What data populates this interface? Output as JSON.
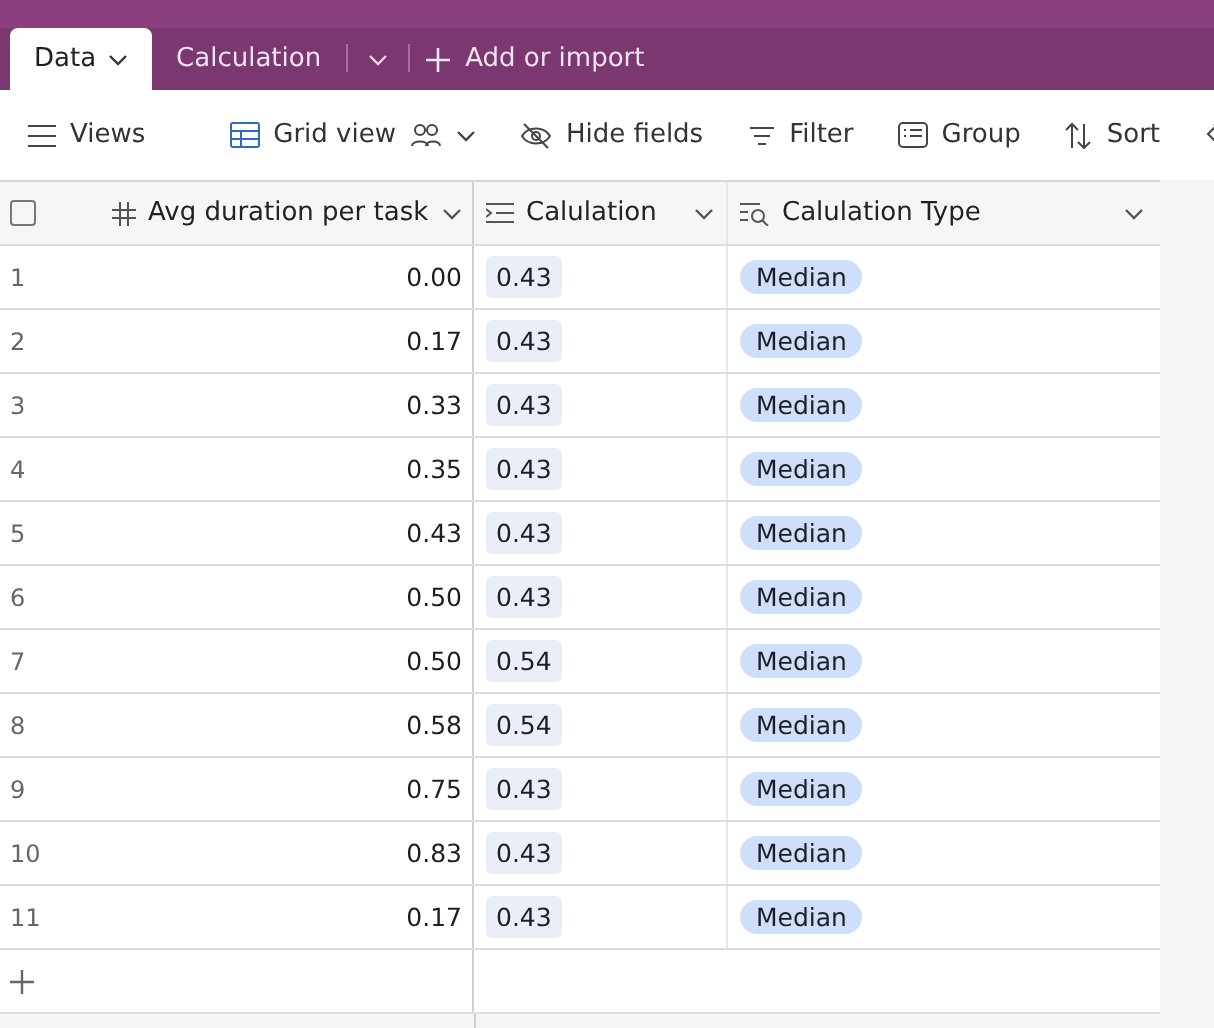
{
  "tabs": [
    {
      "label": "Data",
      "selected": true
    },
    {
      "label": "Calculation",
      "selected": false
    }
  ],
  "add_tab": {
    "label": "Add or import"
  },
  "toolbar": {
    "views": "Views",
    "view_name": "Grid view",
    "items": [
      {
        "kind": "hide",
        "label": "Hide fields"
      },
      {
        "kind": "filter",
        "label": "Filter"
      },
      {
        "kind": "group",
        "label": "Group"
      },
      {
        "kind": "sort",
        "label": "Sort"
      },
      {
        "kind": "color"
      }
    ]
  },
  "select_all": {
    "checked": false
  },
  "table": {
    "columns": [
      {
        "kind": "number",
        "label": "Avg duration per task"
      },
      {
        "kind": "formula",
        "label": "Calulation"
      },
      {
        "kind": "lookup",
        "label": "Calulation Type"
      }
    ],
    "rows": [
      {
        "index": "1",
        "avg": "0.00",
        "calc": "0.43",
        "type": "Median"
      },
      {
        "index": "2",
        "avg": "0.17",
        "calc": "0.43",
        "type": "Median"
      },
      {
        "index": "3",
        "avg": "0.33",
        "calc": "0.43",
        "type": "Median"
      },
      {
        "index": "4",
        "avg": "0.35",
        "calc": "0.43",
        "type": "Median"
      },
      {
        "index": "5",
        "avg": "0.43",
        "calc": "0.43",
        "type": "Median"
      },
      {
        "index": "6",
        "avg": "0.50",
        "calc": "0.43",
        "type": "Median"
      },
      {
        "index": "7",
        "avg": "0.50",
        "calc": "0.54",
        "type": "Median"
      },
      {
        "index": "8",
        "avg": "0.58",
        "calc": "0.54",
        "type": "Median"
      },
      {
        "index": "9",
        "avg": "0.75",
        "calc": "0.43",
        "type": "Median"
      },
      {
        "index": "10",
        "avg": "0.83",
        "calc": "0.43",
        "type": "Median"
      },
      {
        "index": "11",
        "avg": "0.17",
        "calc": "0.43",
        "type": "Median"
      }
    ]
  }
}
